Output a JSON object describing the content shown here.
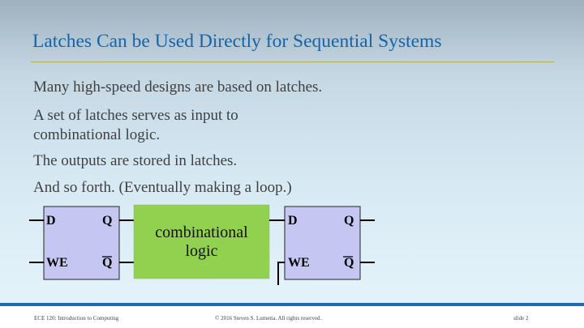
{
  "slide": {
    "title": "Latches Can be Used Directly for Sequential Systems",
    "bullets": [
      "Many high-speed designs are based on latches.",
      "A set of latches serves as input to combinational logic.",
      "The outputs are stored in latches.",
      "And so forth.  (Eventually making a loop.)"
    ]
  },
  "diagram": {
    "latch_left": {
      "d_label": "D",
      "q_label": "Q",
      "we_label": "WE",
      "qbar_label": "Q"
    },
    "combinational": {
      "line1": "combinational",
      "line2": "logic"
    },
    "latch_right": {
      "d_label": "D",
      "q_label": "Q",
      "we_label": "WE",
      "qbar_label": "Q"
    }
  },
  "footer": {
    "left": "ECE 120: Introduction to Computing",
    "center": "© 2016 Steven S. Lumetta.  All rights reserved.",
    "right": "slide 2"
  },
  "colors": {
    "title": "#1664a8",
    "latch_fill": "#c6c6f2",
    "logic_fill": "#92d050",
    "footer_bar": "#1f6db5"
  }
}
